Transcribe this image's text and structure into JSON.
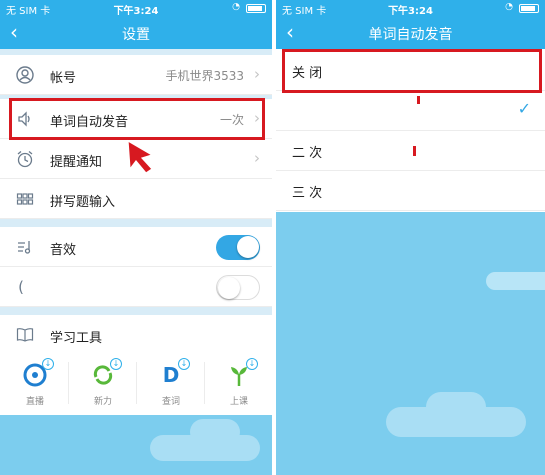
{
  "status_bar": {
    "carrier": "无 SIM 卡 ",
    "time": "下午3:24"
  },
  "settings_screen": {
    "title": "设置",
    "account": {
      "label": "帐号",
      "value": "手机世界3533"
    },
    "auto_pronounce": {
      "label": "单词自动发音",
      "value": "一次"
    },
    "reminder": {
      "label": "提醒通知"
    },
    "spelling_input": {
      "label": "拼写题输入"
    },
    "sound_effect": {
      "label": "音效",
      "enabled": true
    },
    "second_toggle": {
      "enabled": false
    },
    "study_tools": {
      "label": "学习工具",
      "items": [
        {
          "label": "直播",
          "icon": "live-icon",
          "color": "#1f7fd0"
        },
        {
          "label": "新力",
          "icon": "refresh-arrows-icon",
          "color": "#58b83a"
        },
        {
          "label": "查词",
          "icon": "dictionary-d-icon",
          "color": "#1f7fd0"
        },
        {
          "label": "上课",
          "icon": "sprout-icon",
          "color": "#58b83a"
        }
      ]
    }
  },
  "pronounce_screen": {
    "title": "单词自动发音",
    "options": [
      {
        "label": "关 闭",
        "selected": false
      },
      {
        "label": "",
        "selected": true
      },
      {
        "label": "二 次",
        "selected": false
      },
      {
        "label": "三 次",
        "selected": false
      }
    ]
  },
  "colors": {
    "primary": "#2fb0ea",
    "highlight": "#d71920",
    "toggle_on": "#33a7e4",
    "sky": "#7ccdee"
  }
}
